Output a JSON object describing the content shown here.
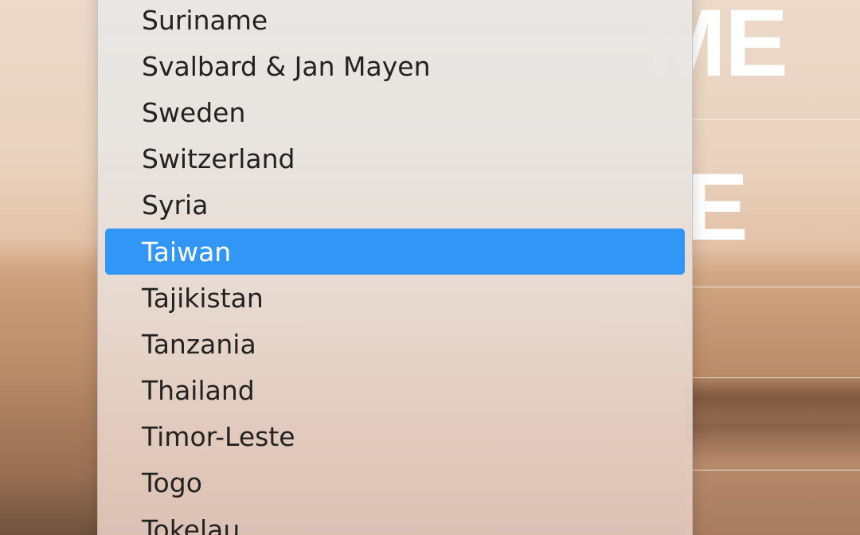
{
  "background": {
    "headline_fragment_1": "ME",
    "headline_fragment_2": "E"
  },
  "country_menu": {
    "selected": "Taiwan",
    "accent_color": "#3296f7",
    "items": [
      "Suriname",
      "Svalbard & Jan Mayen",
      "Sweden",
      "Switzerland",
      "Syria",
      "Taiwan",
      "Tajikistan",
      "Tanzania",
      "Thailand",
      "Timor-Leste",
      "Togo",
      "Tokelau"
    ]
  }
}
